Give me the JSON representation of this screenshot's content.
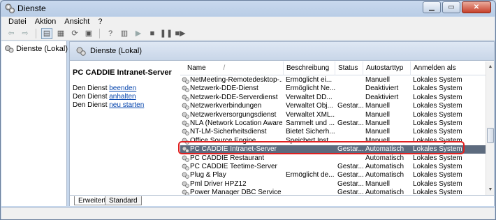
{
  "window": {
    "title": "Dienste",
    "title_icon": "services-gear-icon"
  },
  "menu": [
    "Datei",
    "Aktion",
    "Ansicht",
    "?"
  ],
  "tree": {
    "root_label": "Dienste (Lokal)"
  },
  "pane_header": "Dienste (Lokal)",
  "detail": {
    "service_name": "PC CADDIE Intranet-Server",
    "lines": [
      {
        "prefix": "Den Dienst ",
        "link": "beenden"
      },
      {
        "prefix": "Den Dienst ",
        "link": "anhalten"
      },
      {
        "prefix": "Den Dienst ",
        "link": "neu starten"
      }
    ]
  },
  "columns": {
    "name": "Name",
    "sort_indicator": "/",
    "description": "Beschreibung",
    "status": "Status",
    "startup": "Autostarttyp",
    "logon": "Anmelden als"
  },
  "services": [
    {
      "name": "NetMeeting-Remotedesktop-...",
      "desc": "Ermöglicht ei...",
      "status": "",
      "startup": "Manuell",
      "logon": "Lokales System"
    },
    {
      "name": "Netzwerk-DDE-Dienst",
      "desc": "Ermöglicht Ne...",
      "status": "",
      "startup": "Deaktiviert",
      "logon": "Lokales System"
    },
    {
      "name": "Netzwerk-DDE-Serverdienst",
      "desc": "Verwaltet DD...",
      "status": "",
      "startup": "Deaktiviert",
      "logon": "Lokales System"
    },
    {
      "name": "Netzwerkverbindungen",
      "desc": "Verwaltet Obj...",
      "status": "Gestar...",
      "startup": "Manuell",
      "logon": "Lokales System"
    },
    {
      "name": "Netzwerkversorgungsdienst",
      "desc": "Verwaltet XML...",
      "status": "",
      "startup": "Manuell",
      "logon": "Lokales System"
    },
    {
      "name": "NLA (Network Location Aware...",
      "desc": "Sammelt und ...",
      "status": "Gestar...",
      "startup": "Manuell",
      "logon": "Lokales System"
    },
    {
      "name": "NT-LM-Sicherheitsdienst",
      "desc": "Bietet Sicherh...",
      "status": "",
      "startup": "Manuell",
      "logon": "Lokales System"
    },
    {
      "name": "Office Source Engine",
      "desc": "Speichert Inst...",
      "status": "",
      "startup": "Manuell",
      "logon": "Lokales System"
    },
    {
      "name": "PC CADDIE Intranet-Server",
      "desc": "",
      "status": "Gestar...",
      "startup": "Automatisch",
      "logon": "Lokales System",
      "selected": true
    },
    {
      "name": "PC CADDIE Restaurant",
      "desc": "",
      "status": "",
      "startup": "Automatisch",
      "logon": "Lokales System"
    },
    {
      "name": "PC CADDIE Teetime-Server",
      "desc": "",
      "status": "Gestar...",
      "startup": "Automatisch",
      "logon": "Lokales System"
    },
    {
      "name": "Plug & Play",
      "desc": "Ermöglicht de...",
      "status": "Gestar...",
      "startup": "Automatisch",
      "logon": "Lokales System"
    },
    {
      "name": "Pml Driver HPZ12",
      "desc": "",
      "status": "Gestar...",
      "startup": "Manuell",
      "logon": "Lokales System"
    },
    {
      "name": "Power Manager DBC Service",
      "desc": "",
      "status": "Gestar...",
      "startup": "Automatisch",
      "logon": "Lokales System"
    }
  ],
  "tabs": [
    "Erweitert",
    "Standard"
  ]
}
